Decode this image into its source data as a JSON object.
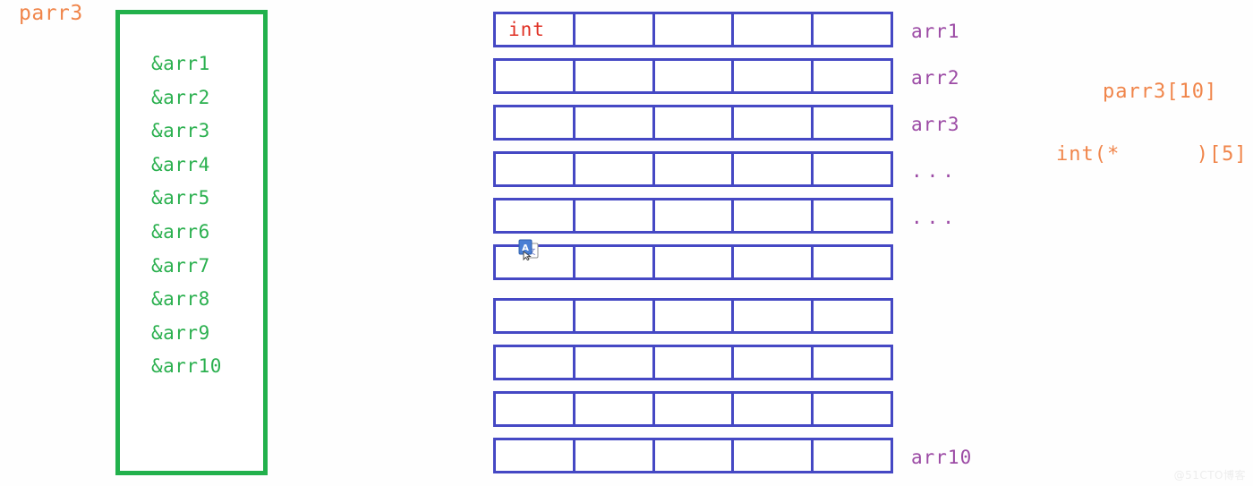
{
  "diagram": {
    "left_label": "parr3",
    "pointer_box": {
      "items": [
        "&arr1",
        "&arr2",
        "&arr3",
        "&arr4",
        "&arr5",
        "&arr6",
        "&arr7",
        "&arr8",
        "&arr9",
        "&arr10"
      ],
      "border_color": "#22b14c",
      "text_color": "#2bb04f"
    },
    "grid": {
      "columns": 5,
      "rows": [
        {
          "cells": [
            "int",
            "",
            "",
            "",
            ""
          ],
          "label": "arr1"
        },
        {
          "cells": [
            "",
            "",
            "",
            "",
            ""
          ],
          "label": "arr2"
        },
        {
          "cells": [
            "",
            "",
            "",
            "",
            ""
          ],
          "label": "arr3"
        },
        {
          "cells": [
            "",
            "",
            "",
            "",
            ""
          ],
          "label": "..."
        },
        {
          "cells": [
            "",
            "",
            "",
            "",
            ""
          ],
          "label": "..."
        },
        {
          "cells": [
            "",
            "",
            "",
            "",
            ""
          ],
          "label": ""
        },
        {
          "cells": [
            "",
            "",
            "",
            "",
            ""
          ],
          "label": ""
        },
        {
          "cells": [
            "",
            "",
            "",
            "",
            ""
          ],
          "label": ""
        },
        {
          "cells": [
            "",
            "",
            "",
            "",
            ""
          ],
          "label": ""
        },
        {
          "cells": [
            "",
            "",
            "",
            "",
            ""
          ],
          "label": "arr10"
        }
      ],
      "border_color": "#4548c4",
      "cell_text_color": "#e03226",
      "label_color": "#9c4ba5"
    },
    "annotations": {
      "array_decl": "parr3[10]",
      "pointer_decl": "int(*      )[5]",
      "color": "#f0854a"
    },
    "cursor_icon": "translate-icon",
    "watermark": "@51CTO博客"
  }
}
